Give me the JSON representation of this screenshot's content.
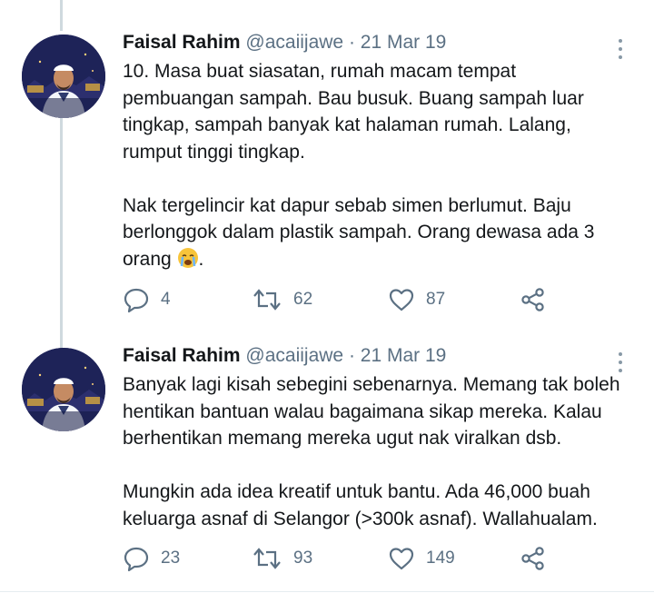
{
  "tweets": [
    {
      "name": "Faisal Rahim",
      "handle": "@acaiijawe",
      "separator": "·",
      "date": "21 Mar 19",
      "text_main": "10. Masa buat siasatan, rumah macam tempat\npembuangan sampah. Bau busuk. Buang sampah luar\ntingkap, sampah banyak kat halaman rumah. Lalang,\nrumput tinggi tingkap.\n\nNak tergelincir kat dapur sebab simen berlumut. Baju\nberlonggok dalam plastik sampah. Orang dewasa ada 3\norang ",
      "text_emoji": "crying-face",
      "text_end": ".",
      "replies": "4",
      "retweets": "62",
      "likes": "87"
    },
    {
      "name": "Faisal Rahim",
      "handle": "@acaiijawe",
      "separator": "·",
      "date": "21 Mar 19",
      "text_main": "Banyak lagi kisah sebegini sebenarnya. Memang tak boleh\nhentikan bantuan walau bagaimana sikap mereka. Kalau\nberhentikan memang mereka ugut nak viralkan dsb.\n\nMungkin ada idea kreatif untuk bantu. Ada 46,000 buah\nkeluarga asnaf di Selangor (>300k asnaf). Wallahualam.",
      "replies": "23",
      "retweets": "93",
      "likes": "149"
    }
  ],
  "colors": {
    "text": "#14171a",
    "secondary": "#5b7083",
    "thread_line": "#cfd9de",
    "divider": "#e6ecf0"
  },
  "icons": {
    "reply": "speech-bubble-icon",
    "retweet": "retweet-arrows-icon",
    "like": "heart-outline-icon",
    "share": "share-nodes-icon",
    "more": "vertical-ellipsis-icon"
  }
}
